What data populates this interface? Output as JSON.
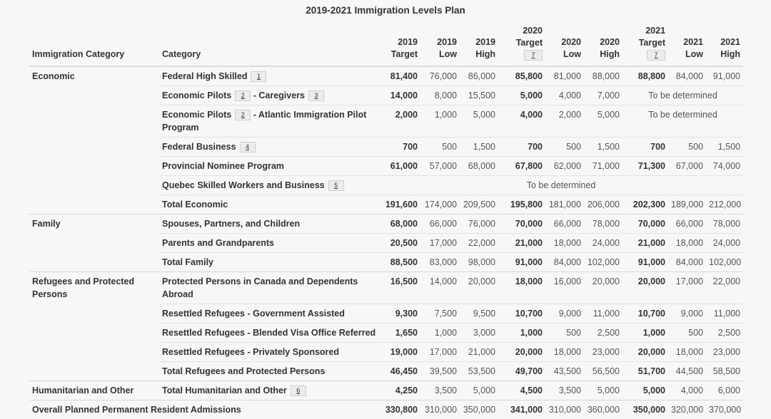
{
  "title": "2019-2021 Immigration Levels Plan",
  "columns": {
    "immigration_category": "Immigration Category",
    "category": "Category",
    "y2019_target": [
      "2019",
      "Target"
    ],
    "y2019_low": [
      "2019",
      "Low"
    ],
    "y2019_high": [
      "2019",
      "High"
    ],
    "y2020_target": [
      "2020",
      "Target"
    ],
    "y2020_target_footnote": "7",
    "y2020_low": [
      "2020",
      "Low"
    ],
    "y2020_high": [
      "2020",
      "High"
    ],
    "y2021_target": [
      "2021",
      "Target"
    ],
    "y2021_target_footnote": "7",
    "y2021_low": [
      "2021",
      "Low"
    ],
    "y2021_high": [
      "2021",
      "High"
    ]
  },
  "tbd_text": "To be determined",
  "groups": {
    "economic": {
      "label": "Economic",
      "rows": [
        {
          "category": "Federal High Skilled",
          "footnote": "1",
          "values": [
            "81,400",
            "76,000",
            "86,000",
            "85,800",
            "81,000",
            "88,000",
            "88,800",
            "84,000",
            "91,000"
          ]
        },
        {
          "category_parts": [
            "Economic Pilots",
            "- Caregivers"
          ],
          "footnotes": [
            "2",
            "3"
          ],
          "values": [
            "14,000",
            "8,000",
            "15,500",
            "5,000",
            "4,000",
            "7,000"
          ],
          "tbd_2021": true
        },
        {
          "category_parts": [
            "Economic Pilots",
            "- Atlantic Immigration Pilot Program"
          ],
          "footnotes": [
            "2"
          ],
          "values": [
            "2,000",
            "1,000",
            "5,000",
            "4,000",
            "2,000",
            "5,000"
          ],
          "tbd_2021": true
        },
        {
          "category": "Federal Business",
          "footnote": "4",
          "values": [
            "700",
            "500",
            "1,500",
            "700",
            "500",
            "1,500",
            "700",
            "500",
            "1,500"
          ]
        },
        {
          "category": "Provincial Nominee Program",
          "values": [
            "61,000",
            "57,000",
            "68,000",
            "67,800",
            "62,000",
            "71,000",
            "71,300",
            "67,000",
            "74,000"
          ]
        },
        {
          "category": "Quebec Skilled Workers and Business",
          "footnote": "5",
          "tbd_all": true
        },
        {
          "category": "Total Economic",
          "values": [
            "191,600",
            "174,000",
            "209,500",
            "195,800",
            "181,000",
            "206,000",
            "202,300",
            "189,000",
            "212,000"
          ]
        }
      ]
    },
    "family": {
      "label": "Family",
      "rows": [
        {
          "category": "Spouses, Partners, and Children",
          "values": [
            "68,000",
            "66,000",
            "76,000",
            "70,000",
            "66,000",
            "78,000",
            "70,000",
            "66,000",
            "78,000"
          ]
        },
        {
          "category": "Parents and Grandparents",
          "values": [
            "20,500",
            "17,000",
            "22,000",
            "21,000",
            "18,000",
            "24,000",
            "21,000",
            "18,000",
            "24,000"
          ]
        },
        {
          "category": "Total Family",
          "values": [
            "88,500",
            "83,000",
            "98,000",
            "91,000",
            "84,000",
            "102,000",
            "91,000",
            "84,000",
            "102,000"
          ]
        }
      ]
    },
    "refugees": {
      "label": "Refugees and Protected Persons",
      "rows": [
        {
          "category": "Protected Persons in Canada and Dependents Abroad",
          "values": [
            "16,500",
            "14,000",
            "20,000",
            "18,000",
            "16,000",
            "20,000",
            "20,000",
            "17,000",
            "22,000"
          ]
        },
        {
          "category": "Resettled Refugees - Government Assisted",
          "values": [
            "9,300",
            "7,500",
            "9,500",
            "10,700",
            "9,000",
            "11,000",
            "10,700",
            "9,000",
            "11,000"
          ]
        },
        {
          "category": "Resettled Refugees - Blended Visa Office Referred",
          "values": [
            "1,650",
            "1,000",
            "3,000",
            "1,000",
            "500",
            "2,500",
            "1,000",
            "500",
            "2,500"
          ]
        },
        {
          "category": "Resettled Refugees - Privately Sponsored",
          "values": [
            "19,000",
            "17,000",
            "21,000",
            "20,000",
            "18,000",
            "23,000",
            "20,000",
            "18,000",
            "23,000"
          ]
        },
        {
          "category": "Total Refugees and Protected Persons",
          "values": [
            "46,450",
            "39,500",
            "53,500",
            "49,700",
            "43,500",
            "56,500",
            "51,700",
            "44,500",
            "58,500"
          ]
        }
      ]
    },
    "humanitarian": {
      "label": "Humanitarian and Other",
      "rows": [
        {
          "category": "Total Humanitarian and Other",
          "footnote": "6",
          "values": [
            "4,250",
            "3,500",
            "5,000",
            "4,500",
            "3,500",
            "5,000",
            "5,000",
            "4,000",
            "6,000"
          ]
        }
      ]
    }
  },
  "overall": {
    "label": "Overall Planned Permanent Resident Admissions",
    "values": [
      "330,800",
      "310,000",
      "350,000",
      "341,000",
      "310,000",
      "360,000",
      "350,000",
      "320,000",
      "370,000"
    ]
  }
}
